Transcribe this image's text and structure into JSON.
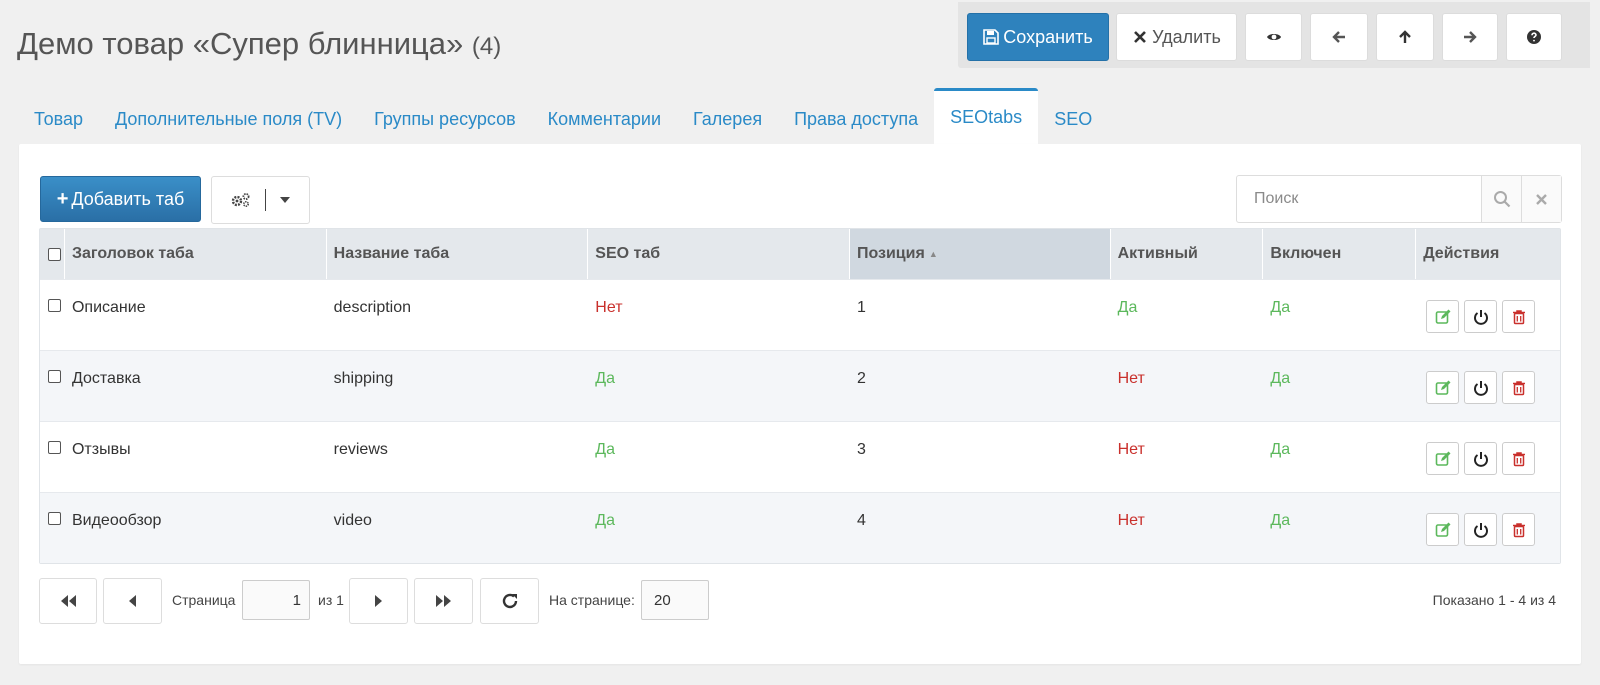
{
  "page": {
    "title": "Демо товар «Супер блинница»",
    "count": "(4)"
  },
  "toolbar": {
    "save_label": "Сохранить",
    "delete_label": "Удалить"
  },
  "tabs": [
    {
      "label": "Товар"
    },
    {
      "label": "Дополнительные поля (TV)"
    },
    {
      "label": "Группы ресурсов"
    },
    {
      "label": "Комментарии"
    },
    {
      "label": "Галерея"
    },
    {
      "label": "Права доступа"
    },
    {
      "label": "SEOtabs"
    },
    {
      "label": "SEO"
    }
  ],
  "active_tab": "SEOtabs",
  "grid": {
    "add_label": "Добавить таб",
    "search_placeholder": "Поиск",
    "columns": [
      "Заголовок таба",
      "Название таба",
      "SEO таб",
      "Позиция",
      "Активный",
      "Включен",
      "Действия"
    ],
    "rows": [
      {
        "title": "Описание",
        "name": "description",
        "seo": "Нет",
        "position": "1",
        "active": "Да",
        "enabled": "Да"
      },
      {
        "title": "Доставка",
        "name": "shipping",
        "seo": "Да",
        "position": "2",
        "active": "Нет",
        "enabled": "Да"
      },
      {
        "title": "Отзывы",
        "name": "reviews",
        "seo": "Да",
        "position": "3",
        "active": "Нет",
        "enabled": "Да"
      },
      {
        "title": "Видеообзор",
        "name": "video",
        "seo": "Да",
        "position": "4",
        "active": "Нет",
        "enabled": "Да"
      }
    ]
  },
  "pager": {
    "page_label": "Страница",
    "page_value": "1",
    "of_label": "из 1",
    "per_page_label": "На странице:",
    "per_page_value": "20",
    "shown": "Показано 1 - 4 из 4"
  },
  "colors": {
    "accent": "#2a8ac7",
    "yes": "#5cb85c",
    "no": "#c9302c"
  }
}
